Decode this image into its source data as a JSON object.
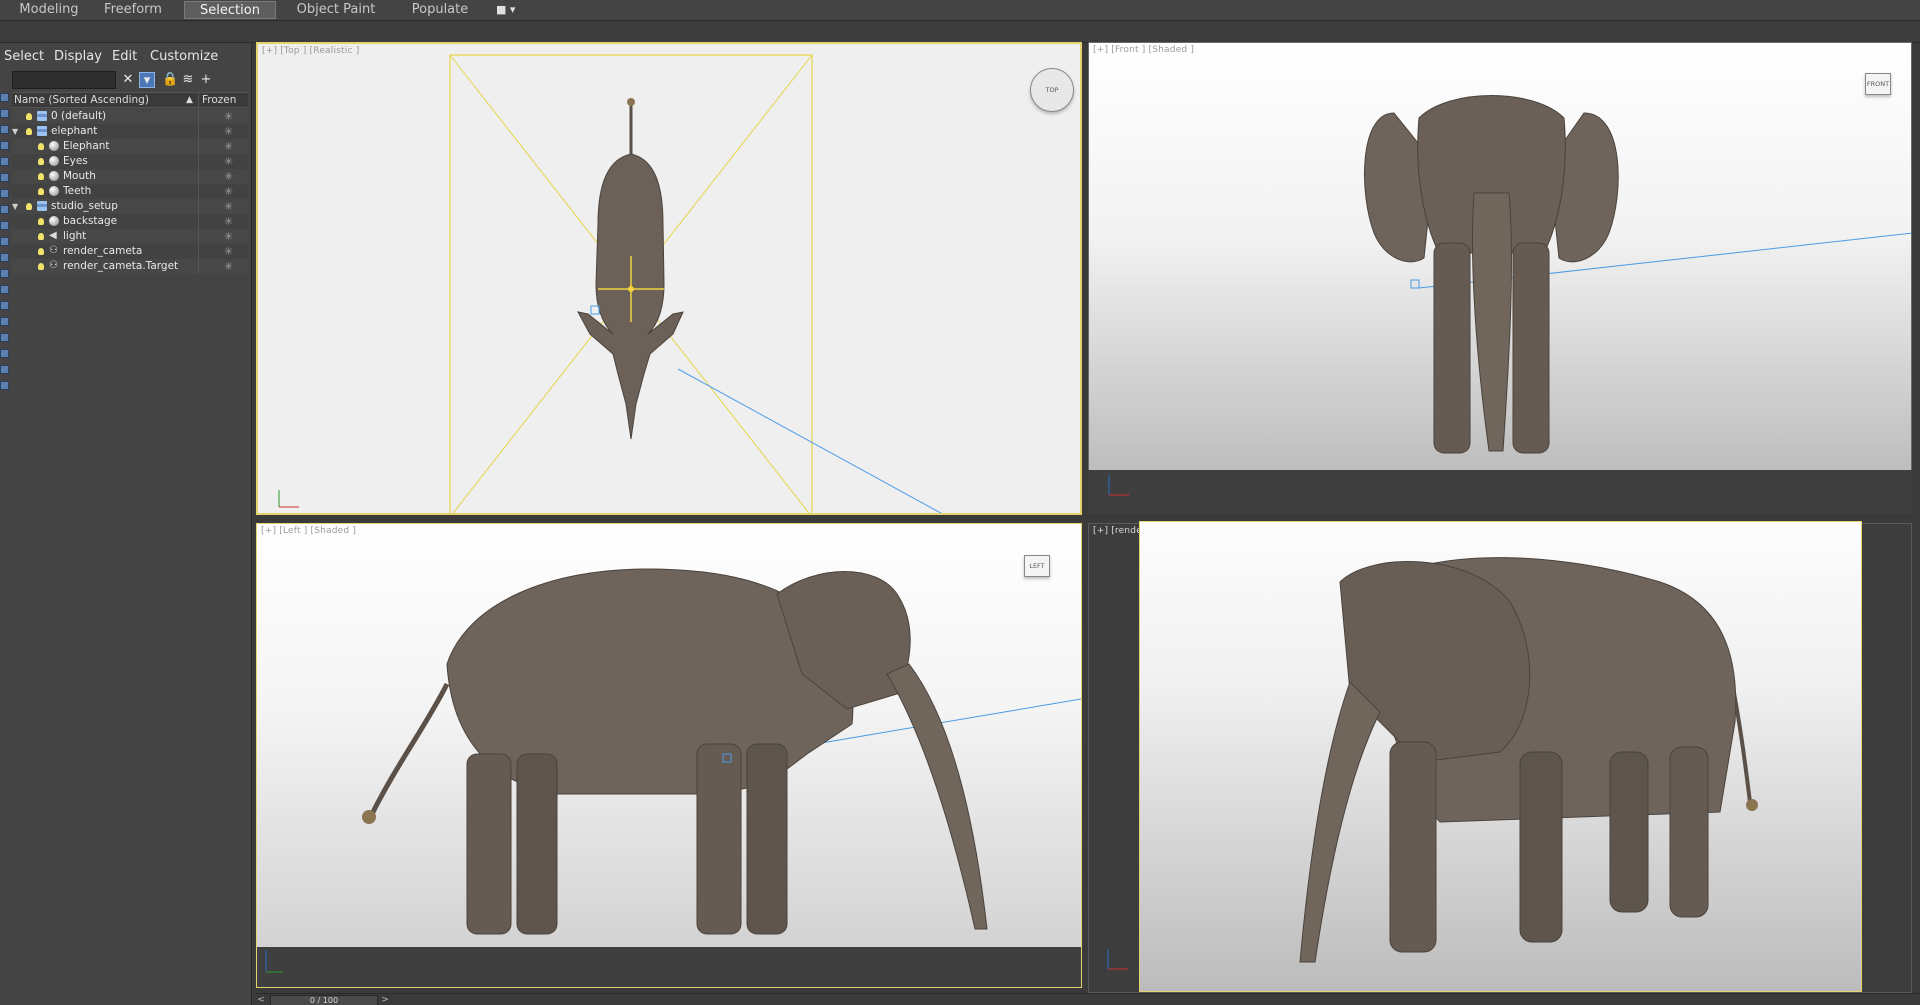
{
  "ribbon": {
    "tabs": [
      "Modeling",
      "Freeform",
      "Selection",
      "Object Paint",
      "Populate"
    ],
    "active_tab": "Selection"
  },
  "explorer": {
    "menus": [
      "Select",
      "Display",
      "Edit",
      "Customize"
    ],
    "columns": {
      "name": "Name (Sorted Ascending)",
      "frozen": "Frozen"
    },
    "rows": [
      {
        "label": "0 (default)",
        "icon": "layer-icon",
        "indent": 0,
        "expand": ""
      },
      {
        "label": "elephant",
        "icon": "layer-icon",
        "indent": 0,
        "expand": "▼"
      },
      {
        "label": "Elephant",
        "icon": "sphere-icon",
        "indent": 1,
        "expand": ""
      },
      {
        "label": "Eyes",
        "icon": "sphere-icon",
        "indent": 1,
        "expand": ""
      },
      {
        "label": "Mouth",
        "icon": "sphere-icon",
        "indent": 1,
        "expand": ""
      },
      {
        "label": "Teeth",
        "icon": "sphere-icon",
        "indent": 1,
        "expand": ""
      },
      {
        "label": "studio_setup",
        "icon": "layer-icon",
        "indent": 0,
        "expand": "▼"
      },
      {
        "label": "backstage",
        "icon": "sphere-icon",
        "indent": 1,
        "expand": ""
      },
      {
        "label": "light",
        "icon": "light-icon",
        "indent": 1,
        "expand": ""
      },
      {
        "label": "render_cameta",
        "icon": "camera-icon",
        "indent": 1,
        "expand": ""
      },
      {
        "label": "render_cameta.Target",
        "icon": "camera-icon",
        "indent": 1,
        "expand": ""
      }
    ]
  },
  "viewports": {
    "top": {
      "label": "[+] [Top ] [Realistic ]",
      "cube": "TOP"
    },
    "front": {
      "label": "[+] [Front ] [Shaded ]",
      "cube": "FRONT"
    },
    "left": {
      "label": "[+] [Left ] [Shaded ]",
      "cube": "LEFT"
    },
    "camera": {
      "label": "[+] [render_cameta ] [Realistic ]"
    }
  },
  "timeline": {
    "frame": "0 / 100",
    "prev": "<",
    "next": ">"
  },
  "colors": {
    "active_border": "#e4d26a",
    "selection_tab": "#5e5e5e",
    "elephant_skin": "#6e645b",
    "camera_line": "#4a9be6"
  }
}
